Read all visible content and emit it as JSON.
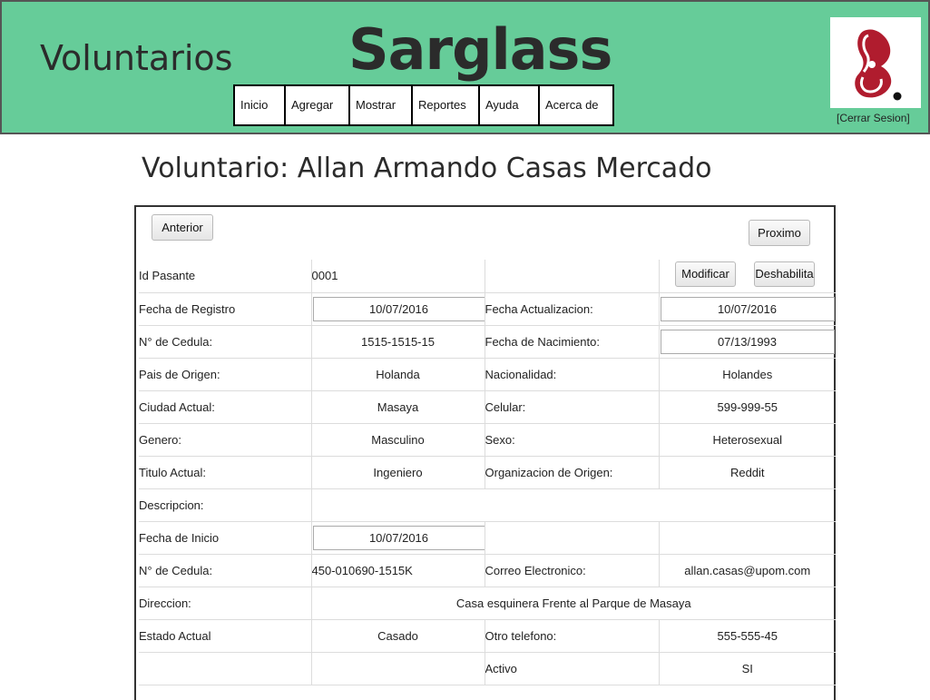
{
  "header": {
    "section": "Voluntarios",
    "brand": "Sarglass",
    "nav": [
      "Inicio",
      "Agregar",
      "Mostrar",
      "Reportes",
      "Ayuda",
      "Acerca de"
    ],
    "logout": "[Cerrar Sesion]"
  },
  "page": {
    "title": "Voluntario: Allan Armando Casas Mercado"
  },
  "buttons": {
    "prev": "Anterior",
    "next": "Proximo",
    "modify": "Modificar",
    "disable": "Deshabilita"
  },
  "form": {
    "id_label": "Id Pasante",
    "id_value": "0001",
    "reg_label": "Fecha de Registro",
    "reg_value": "10/07/2016",
    "upd_label": "Fecha Actualizacion:",
    "upd_value": "10/07/2016",
    "ced_label": "N° de Cedula:",
    "ced_value": "1515-1515-15",
    "birth_label": "Fecha de Nacimiento:",
    "birth_value": "07/13/1993",
    "country_label": "Pais de Origen:",
    "country_value": "Holanda",
    "nat_label": "Nacionalidad:",
    "nat_value": "Holandes",
    "city_label": "Ciudad Actual:",
    "city_value": "Masaya",
    "cell_label": "Celular:",
    "cell_value": "599-999-55",
    "gender_label": "Genero:",
    "gender_value": "Masculino",
    "sex_label": "Sexo:",
    "sex_value": "Heterosexual",
    "title_label": "Titulo Actual:",
    "title_value": "Ingeniero",
    "org_label": "Organizacion de Origen:",
    "org_value": "Reddit",
    "desc_label": "Descripcion:",
    "start_label": "Fecha de Inicio",
    "start_value": "10/07/2016",
    "ced2_label": "N° de Cedula:",
    "ced2_value": "450-010690-1515K",
    "email_label": "Correo Electronico:",
    "email_value": "allan.casas@upom.com",
    "addr_label": "Direccion:",
    "addr_value": "Casa esquinera Frente al Parque de Masaya",
    "state_label": "Estado Actual",
    "state_value": "Casado",
    "phone2_label": "Otro telefono:",
    "phone2_value": "555-555-45",
    "active_label": "Activo",
    "active_value": "SI"
  },
  "colors": {
    "header_bg": "#66cc99",
    "logo_red": "#b01c2e"
  }
}
